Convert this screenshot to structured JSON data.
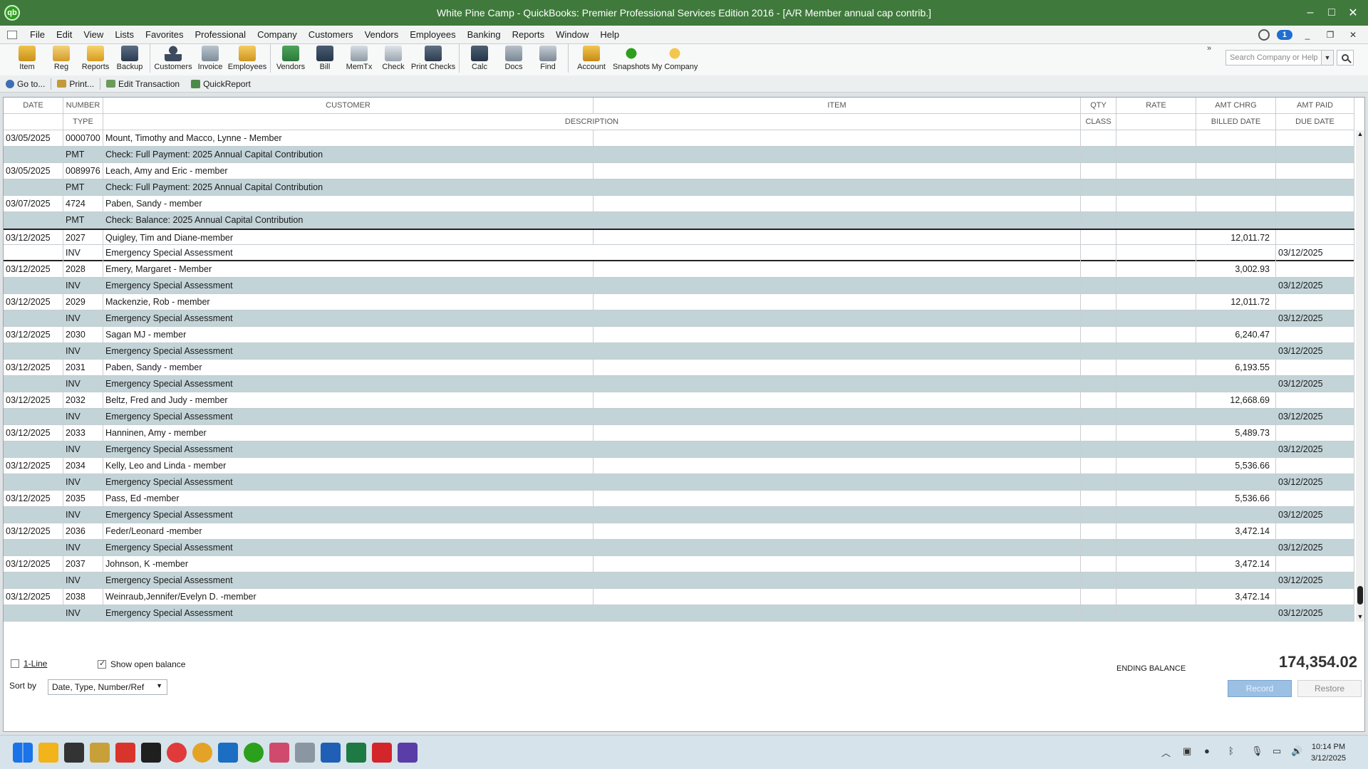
{
  "window": {
    "title": "White Pine Camp  - QuickBooks: Premier Professional Services Edition 2016 - [A/R Member annual cap contrib.]",
    "app_icon": "qb"
  },
  "menu": [
    "File",
    "Edit",
    "View",
    "Lists",
    "Favorites",
    "Professional",
    "Company",
    "Customers",
    "Vendors",
    "Employees",
    "Banking",
    "Reports",
    "Window",
    "Help"
  ],
  "menu_badge": "1",
  "toolbar": [
    {
      "label": "Item",
      "icon": "item-icon"
    },
    {
      "label": "Reg",
      "icon": "register-icon"
    },
    {
      "label": "Reports",
      "icon": "reports-icon"
    },
    {
      "label": "Backup",
      "icon": "backup-icon"
    },
    {
      "label": "Customers",
      "icon": "customers-icon"
    },
    {
      "label": "Invoice",
      "icon": "invoice-icon"
    },
    {
      "label": "Employees",
      "icon": "employees-icon"
    },
    {
      "label": "Vendors",
      "icon": "vendors-icon"
    },
    {
      "label": "Bill",
      "icon": "bill-icon"
    },
    {
      "label": "MemTx",
      "icon": "memorized-transactions-icon"
    },
    {
      "label": "Check",
      "icon": "check-icon"
    },
    {
      "label": "Print Checks",
      "icon": "print-checks-icon"
    },
    {
      "label": "Calc",
      "icon": "calculator-icon"
    },
    {
      "label": "Docs",
      "icon": "docs-icon"
    },
    {
      "label": "Find",
      "icon": "find-icon"
    },
    {
      "label": "Account",
      "icon": "account-icon"
    },
    {
      "label": "Snapshots",
      "icon": "snapshots-icon"
    },
    {
      "label": "My Company",
      "icon": "my-company-icon"
    }
  ],
  "toolbar_more": "»",
  "search": {
    "placeholder": "Search Company or Help"
  },
  "subbar": {
    "goto": "Go to...",
    "print": "Print...",
    "edit": "Edit Transaction",
    "quickreport": "QuickReport"
  },
  "headers": {
    "date": "DATE",
    "number": "NUMBER",
    "customer": "CUSTOMER",
    "item": "ITEM",
    "qty": "QTY",
    "rate": "RATE",
    "amt_chrg": "AMT CHRG",
    "amt_paid": "AMT PAID",
    "type": "TYPE",
    "description": "DESCRIPTION",
    "class": "CLASS",
    "billed_date": "BILLED DATE",
    "due_date": "DUE DATE"
  },
  "transactions": [
    {
      "date": "03/05/2025",
      "number": "0000700",
      "customer": "Mount, Timothy and Macco, Lynne - Member",
      "type": "PMT",
      "description": "Check: Full Payment: 2025 Annual Capital Contribution",
      "amt_chrg": "",
      "due_date": ""
    },
    {
      "date": "03/05/2025",
      "number": "0089976",
      "customer": "Leach, Amy and Eric - member",
      "type": "PMT",
      "description": "Check: Full Payment: 2025 Annual Capital Contribution",
      "amt_chrg": "",
      "due_date": ""
    },
    {
      "date": "03/07/2025",
      "number": "4724",
      "customer": "Paben, Sandy - member",
      "type": "PMT",
      "description": "Check: Balance: 2025 Annual Capital Contribution",
      "amt_chrg": "",
      "due_date": ""
    },
    {
      "date": "03/12/2025",
      "number": "2027",
      "customer": "Quigley, Tim and Diane-member",
      "type": "INV",
      "description": "Emergency Special Assessment",
      "amt_chrg": "12,011.72",
      "due_date": "03/12/2025",
      "selected": true
    },
    {
      "date": "03/12/2025",
      "number": "2028",
      "customer": "Emery, Margaret - Member",
      "type": "INV",
      "description": "Emergency Special Assessment",
      "amt_chrg": "3,002.93",
      "due_date": "03/12/2025"
    },
    {
      "date": "03/12/2025",
      "number": "2029",
      "customer": "Mackenzie, Rob - member",
      "type": "INV",
      "description": "Emergency Special Assessment",
      "amt_chrg": "12,011.72",
      "due_date": "03/12/2025"
    },
    {
      "date": "03/12/2025",
      "number": "2030",
      "customer": "Sagan MJ - member",
      "type": "INV",
      "description": "Emergency Special Assessment",
      "amt_chrg": "6,240.47",
      "due_date": "03/12/2025"
    },
    {
      "date": "03/12/2025",
      "number": "2031",
      "customer": "Paben, Sandy - member",
      "type": "INV",
      "description": "Emergency Special Assessment",
      "amt_chrg": "6,193.55",
      "due_date": "03/12/2025"
    },
    {
      "date": "03/12/2025",
      "number": "2032",
      "customer": "Beltz, Fred and Judy - member",
      "type": "INV",
      "description": "Emergency Special Assessment",
      "amt_chrg": "12,668.69",
      "due_date": "03/12/2025"
    },
    {
      "date": "03/12/2025",
      "number": "2033",
      "customer": "Hanninen, Amy - member",
      "type": "INV",
      "description": "Emergency Special Assessment",
      "amt_chrg": "5,489.73",
      "due_date": "03/12/2025"
    },
    {
      "date": "03/12/2025",
      "number": "2034",
      "customer": "Kelly, Leo and Linda - member",
      "type": "INV",
      "description": "Emergency Special Assessment",
      "amt_chrg": "5,536.66",
      "due_date": "03/12/2025"
    },
    {
      "date": "03/12/2025",
      "number": "2035",
      "customer": "Pass, Ed -member",
      "type": "INV",
      "description": "Emergency Special Assessment",
      "amt_chrg": "5,536.66",
      "due_date": "03/12/2025"
    },
    {
      "date": "03/12/2025",
      "number": "2036",
      "customer": "Feder/Leonard -member",
      "type": "INV",
      "description": "Emergency Special Assessment",
      "amt_chrg": "3,472.14",
      "due_date": "03/12/2025"
    },
    {
      "date": "03/12/2025",
      "number": "2037",
      "customer": "Johnson, K -member",
      "type": "INV",
      "description": "Emergency Special Assessment",
      "amt_chrg": "3,472.14",
      "due_date": "03/12/2025"
    },
    {
      "date": "03/12/2025",
      "number": "2038",
      "customer": "Weinraub,Jennifer/Evelyn D. -member",
      "type": "INV",
      "description": "Emergency Special Assessment",
      "amt_chrg": "3,472.14",
      "due_date": "03/12/2025"
    }
  ],
  "footer": {
    "one_line": "1-Line",
    "show_open_balance": "Show open balance",
    "sort_by_label": "Sort by",
    "sort_by_value": "Date, Type, Number/Ref",
    "ending_balance_label": "ENDING BALANCE",
    "ending_balance": "174,354.02",
    "record": "Record",
    "restore": "Restore"
  },
  "taskbar": {
    "apps": [
      "start-icon",
      "file-explorer-icon",
      "app-icon",
      "app-icon",
      "app-icon",
      "app-icon",
      "vivaldi-icon",
      "chrome-icon",
      "outlook-icon",
      "quickbooks-icon",
      "snipping-icon",
      "printer-icon",
      "word-icon",
      "excel-icon",
      "acrobat-icon",
      "app-icon"
    ],
    "time": "10:14 PM",
    "date": "3/12/2025"
  }
}
